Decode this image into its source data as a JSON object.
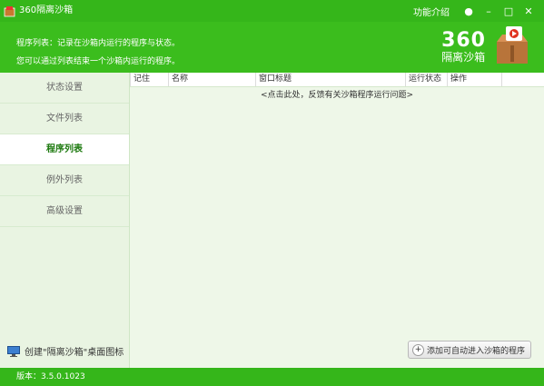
{
  "window": {
    "title": "360隔离沙箱",
    "func_intro": "功能介绍",
    "btn_help": "●",
    "btn_minimize": "–",
    "btn_maximize": "□",
    "btn_close": "✕"
  },
  "header": {
    "line1": "程序列表：记录在沙箱内运行的程序与状态。",
    "line2": "您可以通过列表结束一个沙箱内运行的程序。",
    "brand_number": "360",
    "brand_name": "隔离沙箱",
    "brand_icon": "sandbox-box-icon"
  },
  "sidebar": {
    "items": [
      {
        "label": "状态设置",
        "active": false
      },
      {
        "label": "文件列表",
        "active": false
      },
      {
        "label": "程序列表",
        "active": true
      },
      {
        "label": "例外列表",
        "active": false
      },
      {
        "label": "高级设置",
        "active": false
      }
    ],
    "shortcut_label": "创建\"隔离沙箱\"桌面图标"
  },
  "table": {
    "columns": [
      "记住",
      "名称",
      "窗口标题",
      "运行状态",
      "操作"
    ],
    "empty_hint": "<点击此处，反馈有关沙箱程序运行问题>"
  },
  "actions": {
    "add_button": "添加可自动进入沙箱的程序"
  },
  "status": {
    "version": "版本：3.5.0.1023"
  },
  "colors": {
    "accent": "#35b61a",
    "sidebar_bg": "#e9f4e2",
    "main_bg": "#eef7e8"
  }
}
